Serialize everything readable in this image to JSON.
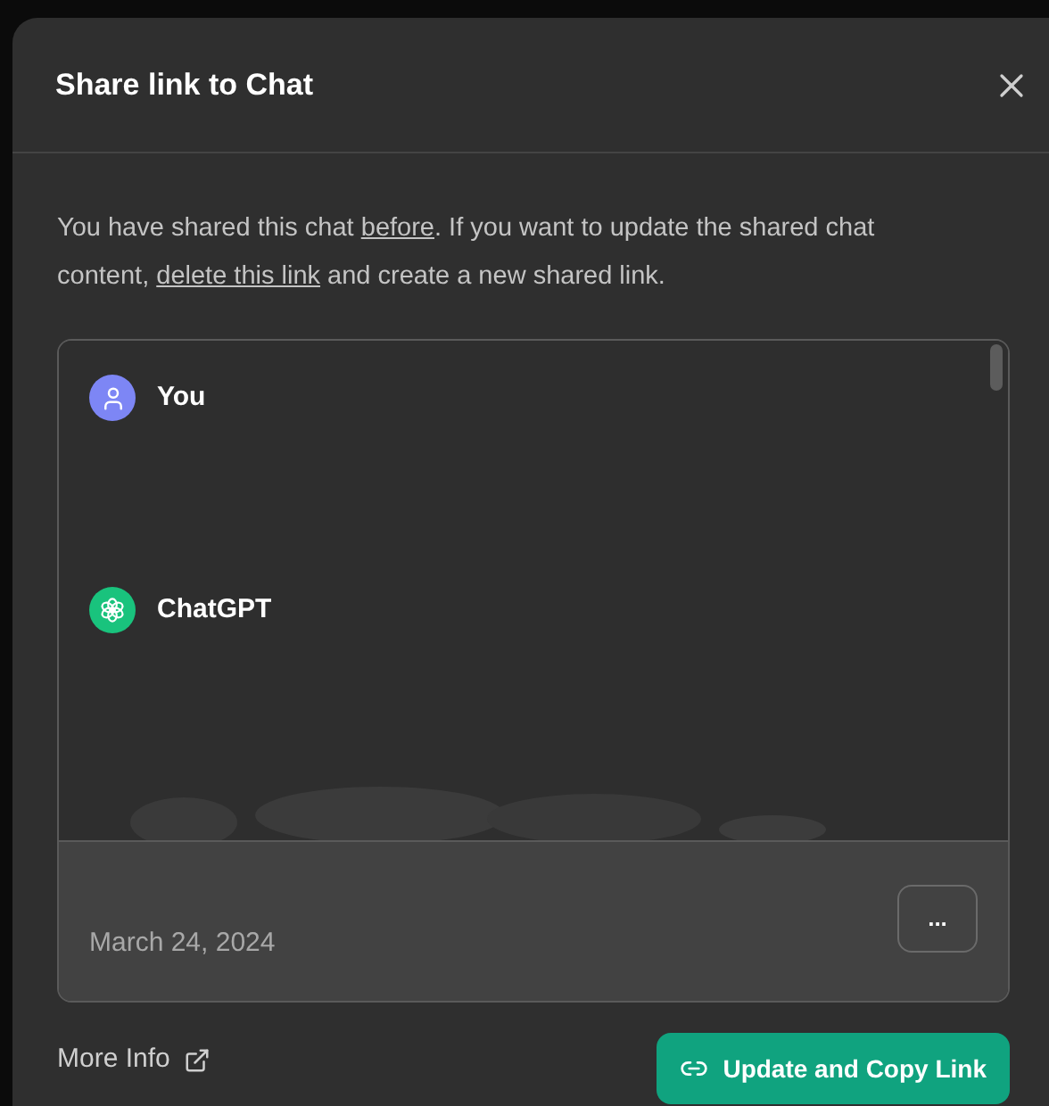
{
  "dialog": {
    "title": "Share link to Chat"
  },
  "notice": [
    {
      "kind": "text",
      "text": "You have shared this chat "
    },
    {
      "kind": "link",
      "text": "before"
    },
    {
      "kind": "text",
      "text": ". If you want to update the shared chat content, "
    },
    {
      "kind": "link",
      "text": "delete this link"
    },
    {
      "kind": "text",
      "text": " and create a new shared link."
    }
  ],
  "preview": {
    "messages": [
      {
        "kind": "user",
        "author": "You"
      },
      {
        "kind": "assistant",
        "author": "ChatGPT"
      }
    ],
    "date": "March 24, 2024",
    "menu_button": "..."
  },
  "footer": {
    "more_info": "More Info",
    "action": "Update and Copy Link"
  }
}
